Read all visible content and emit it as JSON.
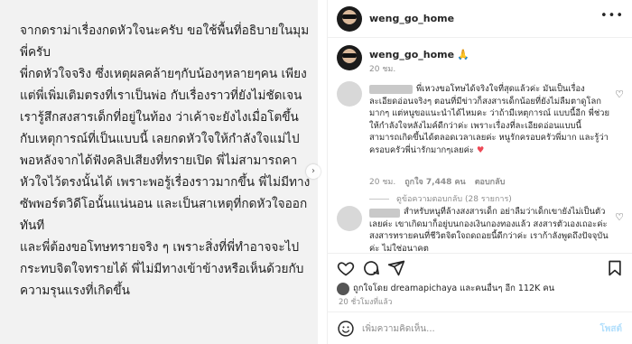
{
  "post_image": {
    "paragraphs": [
      "จากดราม่าเรื่องกดหัวใจนะครับ ขอใช้พื้นที่อธิบายในมุมพี่ครับ",
      "พี่กดหัวใจจริง ซึ่งเหตุผลคล้ายๆกับน้องๆหลายๆคน เพียงแต่พี่เพิ่มเติมตรงที่เราเป็นพ่อ กับเรื่องราวที่ยังไม่ชัดเจน เรารู้สึกสงสารเด็กที่อยู่ในท้อง ว่าเค้าจะยังไงเมื่อโตขึ้นกับเหตุการณ์ที่เป็นแบบนี้ เลยกดหัวใจให้กำลังใจแม่ไป",
      "พอหลังจากได้ฟังคลิปเสียงที่ทรายเปิด พี่ไม่สามารถคาหัวใจไว้ตรงนั้นได้ เพราะพอรู้เรื่องราวมากขึ้น พี่ไม่มีทางซัพพอร์ตวิดีโอนั้นแน่นอน และเป็นสาเหตุที่กดหัวใจออกทันที",
      "และพี่ต้องขอโทษทรายจริง ๆ เพราะสิ่งที่พี่ทำอาจจะไปกระทบจิตใจทรายได้ พี่ไม่มีทางเข้าข้างหรือเห็นด้วยกับความรุนแรงที่เกิดขึ้น"
    ],
    "next_arrow": "›"
  },
  "header": {
    "username": "weng_go_home",
    "more_label": "•••"
  },
  "caption": {
    "username": "weng_go_home",
    "emoji": "🙏",
    "time": "20 ชม."
  },
  "comments": [
    {
      "text": "พี่เหวงขอโทษได้จริงใจที่สุดแล้วค่ะ มันเป็นเรื่องละเอียดอ่อนจริงๆ ตอนที่มีข่าวก็สงสารเด็กน้อยที่ยังไม่ลืมตาดูโลกมากๆ แต่หนูขอแนะนำได้ไหมคะ ว่าถ้ามีเหตุการณ์ แบบนี้อีก พี่ช่วยให้กำลังใจหลังไมค์ดีกว่าค่ะ เพราะเรื่องที่ละเอียดอ่อนแบบนี้ สามารถเกิดขึ้นได้ตลอดเวลาเลยค่ะ หนูรักครอบครัวพี่มาก และรู้ว่าครอบครัวพี่น่ารักมากๆเลยค่ะ",
      "heart": "♥",
      "time": "20 ชม.",
      "likes": "ถูกใจ 7,448 คน",
      "reply_label": "ตอบกลับ",
      "view_replies": "ดูข้อความตอบกลับ (28 รายการ)"
    },
    {
      "text": "สำหรับหนูที่ล้างสงสารเด็ก อย่าลืมว่าเด็กเขายังไม่เป็นตัวเลยค่ะ เขาเกิดมาก็อยู่บนกองเงินกองทองแล้ว สงสารตัวเองเถอะค่ะ สงสารทรายคนที่ชีวิตจิตใจถดถอยนี้ดีกว่าค่ะ เราก้าลังพูดถึงปัจจุบันค่ะ ไม่ใช่อนาคต"
    }
  ],
  "post_stats": {
    "liked_by": "ถูกใจโดย dreamapichaya และคนอื่นๆ อีก 112K คน",
    "posted_time": "20 ชั่วโมงที่แล้ว"
  },
  "comment_box": {
    "placeholder": "เพิ่มความคิดเห็น...",
    "post_label": "โพสต์"
  }
}
